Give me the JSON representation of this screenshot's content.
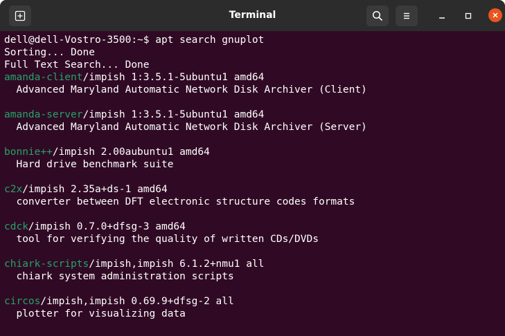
{
  "window": {
    "title": "Terminal",
    "icons": {
      "new_tab": "new-tab-icon",
      "search": "search-icon",
      "menu": "hamburger-menu-icon",
      "minimize": "minimize-icon",
      "maximize": "maximize-icon",
      "close": "close-icon"
    },
    "colors": {
      "terminal_bg": "#300a24",
      "titlebar_bg": "#2c2c2c",
      "package_name": "#26a269",
      "text": "#ffffff",
      "close_button": "#e95420"
    }
  },
  "terminal": {
    "prompt": "dell@dell-Vostro-3500:~$ ",
    "command": "apt search gnuplot",
    "status_lines": [
      "Sorting... Done",
      "Full Text Search... Done"
    ],
    "packages": [
      {
        "name": "amanda-client",
        "info": "/impish 1:3.5.1-5ubuntu1 amd64",
        "description": "  Advanced Maryland Automatic Network Disk Archiver (Client)"
      },
      {
        "name": "amanda-server",
        "info": "/impish 1:3.5.1-5ubuntu1 amd64",
        "description": "  Advanced Maryland Automatic Network Disk Archiver (Server)"
      },
      {
        "name": "bonnie++",
        "info": "/impish 2.00aubuntu1 amd64",
        "description": "  Hard drive benchmark suite"
      },
      {
        "name": "c2x",
        "info": "/impish 2.35a+ds-1 amd64",
        "description": "  converter between DFT electronic structure codes formats"
      },
      {
        "name": "cdck",
        "info": "/impish 0.7.0+dfsg-3 amd64",
        "description": "  tool for verifying the quality of written CDs/DVDs"
      },
      {
        "name": "chiark-scripts",
        "info": "/impish,impish 6.1.2+nmu1 all",
        "description": "  chiark system administration scripts"
      },
      {
        "name": "circos",
        "info": "/impish,impish 0.69.9+dfsg-2 all",
        "description": "  plotter for visualizing data"
      }
    ]
  }
}
